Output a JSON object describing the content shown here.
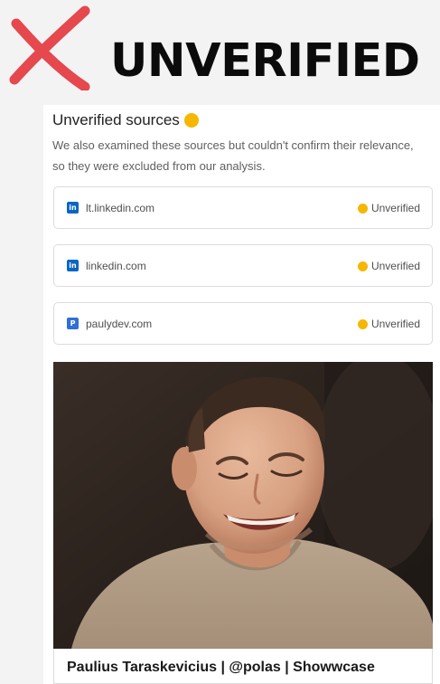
{
  "banner": {
    "title": "UNVERIFIED",
    "mark_icon": "red-x-mark-icon",
    "mark_color": "#e5484d"
  },
  "unverified_sources": {
    "title": "Unverified sources",
    "title_icon": "warning-dot-icon",
    "description": "We also examined these sources but couldn't confirm their relevance, so they were excluded from our analysis.",
    "accent_color": "#f5b700",
    "items": [
      {
        "icon": "linkedin-icon",
        "icon_glyph": "in",
        "label": "lt.linkedin.com",
        "status": "Unverified"
      },
      {
        "icon": "linkedin-icon",
        "icon_glyph": "in",
        "label": "linkedin.com",
        "status": "Unverified"
      },
      {
        "icon": "paulydev-favicon-icon",
        "icon_glyph": "P",
        "label": "paulydev.com",
        "status": "Unverified"
      }
    ]
  },
  "result_card": {
    "image": "profile-photo",
    "title": "Paulius Taraskevicius | @polas | Showwcase"
  }
}
